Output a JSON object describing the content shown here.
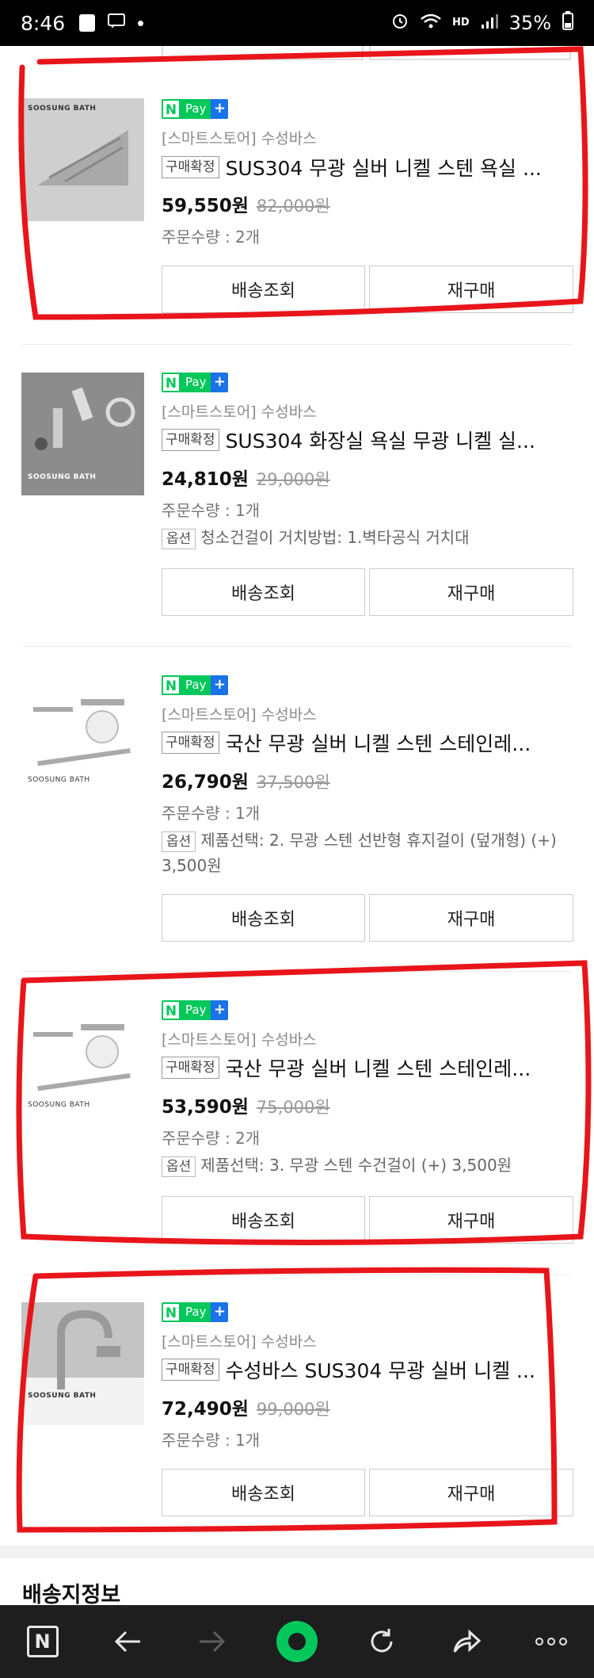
{
  "status_bar": {
    "time": "8:46",
    "hd": "HD",
    "battery": "35%"
  },
  "orders": [
    {
      "npay": "Pay",
      "store": "[스마트스토어] 수성바스",
      "badge": "구매확정",
      "title": "SUS304 무광 실버 니켈 스텐 욕실 ...",
      "price": "59,550원",
      "original_price": "82,000원",
      "quantity": "주문수량 : 2개",
      "thumb_logo": "SOOSUNG BATH",
      "btn_track": "배송조회",
      "btn_rebuy": "재구매"
    },
    {
      "npay": "Pay",
      "store": "[스마트스토어] 수성바스",
      "badge": "구매확정",
      "title": "SUS304 화장실 욕실 무광 니켈 실...",
      "price": "24,810원",
      "original_price": "29,000원",
      "quantity": "주문수량 : 1개",
      "option_label": "옵션",
      "option_text": "청소건걸이 거치방법: 1.벽타공식 거치대",
      "thumb_logo": "SOOSUNG BATH",
      "btn_track": "배송조회",
      "btn_rebuy": "재구매"
    },
    {
      "npay": "Pay",
      "store": "[스마트스토어] 수성바스",
      "badge": "구매확정",
      "title": "국산 무광 실버 니켈 스텐 스테인레...",
      "price": "26,790원",
      "original_price": "37,500원",
      "quantity": "주문수량 : 1개",
      "option_label": "옵션",
      "option_text": "제품선택: 2. 무광 스텐 선반형 휴지걸이 (덮개형) (+) 3,500원",
      "thumb_logo": "SOOSUNG BATH",
      "btn_track": "배송조회",
      "btn_rebuy": "재구매"
    },
    {
      "npay": "Pay",
      "store": "[스마트스토어] 수성바스",
      "badge": "구매확정",
      "title": "국산 무광 실버 니켈 스텐 스테인레...",
      "price": "53,590원",
      "original_price": "75,000원",
      "quantity": "주문수량 : 2개",
      "option_label": "옵션",
      "option_text": "제품선택: 3. 무광 스텐 수건걸이 (+) 3,500원",
      "thumb_logo": "SOOSUNG BATH",
      "btn_track": "배송조회",
      "btn_rebuy": "재구매"
    },
    {
      "npay": "Pay",
      "store": "[스마트스토어] 수성바스",
      "badge": "구매확정",
      "title": "수성바스 SUS304 무광 실버 니켈 ...",
      "price": "72,490원",
      "original_price": "99,000원",
      "quantity": "주문수량 : 1개",
      "thumb_logo": "SOOSUNG BATH",
      "btn_track": "배송조회",
      "btn_rebuy": "재구매"
    }
  ],
  "section_title": "배송지정보",
  "bottom_nav": {
    "home_letter": "N",
    "icons": [
      "n-home-icon",
      "back-arrow-icon",
      "forward-arrow-icon",
      "green-dot-icon",
      "refresh-icon",
      "share-icon",
      "more-icon"
    ]
  },
  "colors": {
    "npay_green": "#03c75a",
    "npay_blue": "#1a73e8",
    "annotation_red": "#e8151b"
  }
}
